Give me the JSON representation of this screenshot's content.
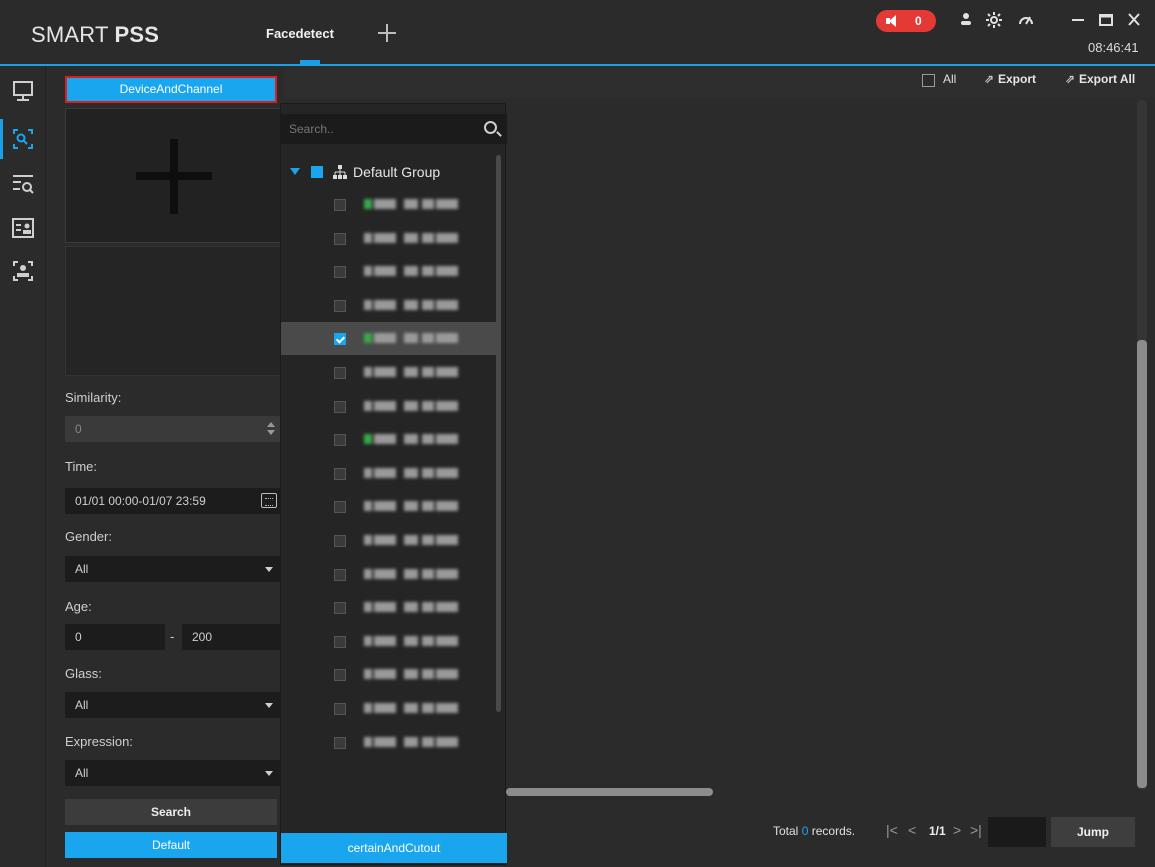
{
  "app": {
    "title_prefix": "SMART ",
    "title_bold": "PSS",
    "active_tab": "Facedetect",
    "clock": "08:46:41",
    "alarm_count": "0"
  },
  "leftnav": {
    "items": [
      {
        "icon": "monitor-icon"
      },
      {
        "icon": "face-detect-icon",
        "active": true
      },
      {
        "icon": "list-search-icon"
      },
      {
        "icon": "id-card-icon"
      },
      {
        "icon": "face-scan-icon"
      }
    ]
  },
  "filter": {
    "device_channel_label": "DeviceAndChannel",
    "similarity_label": "Similarity:",
    "similarity_value": "0",
    "time_label": "Time:",
    "time_value": "01/01 00:00-01/07 23:59",
    "gender_label": "Gender:",
    "gender_value": "All",
    "age_label": "Age:",
    "age_min": "0",
    "age_sep": "-",
    "age_max": "200",
    "glass_label": "Glass:",
    "glass_value": "All",
    "expression_label": "Expression:",
    "expression_value": "All",
    "search_label": "Search",
    "default_label": "Default"
  },
  "toolbar": {
    "all_label": "All",
    "export_label": "Export",
    "export_all_label": "Export All"
  },
  "pager": {
    "total_prefix": "Total",
    "total_count": "0",
    "total_suffix": "records.",
    "page_text": "1/1",
    "jump_label": "Jump"
  },
  "dropdown": {
    "search_placeholder": "Search..",
    "group_name": "Default Group",
    "selected_row_index": 4,
    "device_count": 17,
    "footer_label": "certainAndCutout"
  },
  "colors": {
    "accent": "#1aa6ee",
    "alarm": "#e53935",
    "background": "#2b2b2b"
  }
}
